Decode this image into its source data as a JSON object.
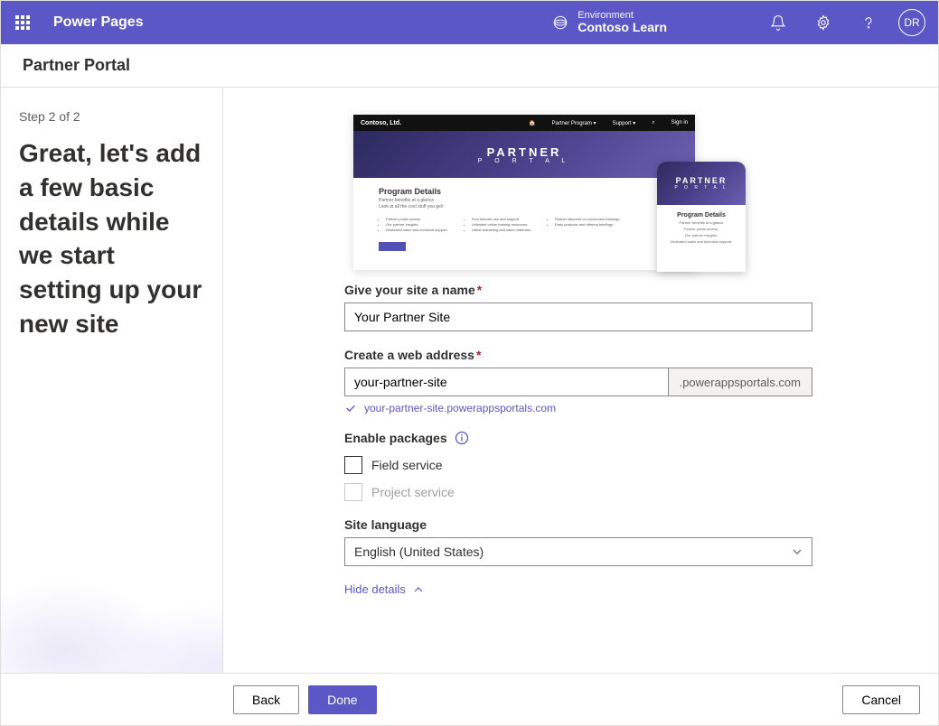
{
  "header": {
    "app_title": "Power Pages",
    "environment_label": "Environment",
    "environment_name": "Contoso Learn",
    "avatar_initials": "DR"
  },
  "sub_header": {
    "title": "Partner Portal"
  },
  "left": {
    "step": "Step 2 of 2",
    "heading": "Great, let's add a few basic details while we start setting up your new site"
  },
  "preview": {
    "company": "Contoso, Ltd.",
    "nav_home": "🏠",
    "nav_partner": "Partner Program ▾",
    "nav_support": "Support ▾",
    "nav_search": "⌕",
    "nav_signin": "Sign in",
    "hero_t1": "PARTNER",
    "hero_t2": "P O R T A L",
    "section_title": "Program Details",
    "section_sub1": "Partner benefits at a glance",
    "section_sub2": "Look at all the cool stuff you get!",
    "col1_a": "Partner portal access.",
    "col1_b": "Our partner insights.",
    "col1_c": "Dedicated sales and technical support.",
    "col2_a": "Free internet use and support.",
    "col2_b": "Unlimited online training resources.",
    "col2_c": "Latest marketing and sales materials.",
    "col3_a": "Partner discount on conversion trainings.",
    "col3_b": "Early products and offering briefings.",
    "mob_a": "Partner portal access.",
    "mob_b": "Our partner insights.",
    "mob_c": "Dedicated sales and technical support."
  },
  "form": {
    "name_label": "Give your site a name",
    "name_value": "Your Partner Site",
    "addr_label": "Create a web address",
    "addr_value": "your-partner-site",
    "addr_suffix": ".powerappsportals.com",
    "addr_validation": "your-partner-site.powerappsportals.com",
    "packages_label": "Enable packages",
    "pkg_field_service": "Field service",
    "pkg_project_service": "Project service",
    "lang_label": "Site language",
    "lang_value": "English (United States)",
    "hide_details": "Hide details"
  },
  "footer": {
    "back": "Back",
    "done": "Done",
    "cancel": "Cancel"
  }
}
